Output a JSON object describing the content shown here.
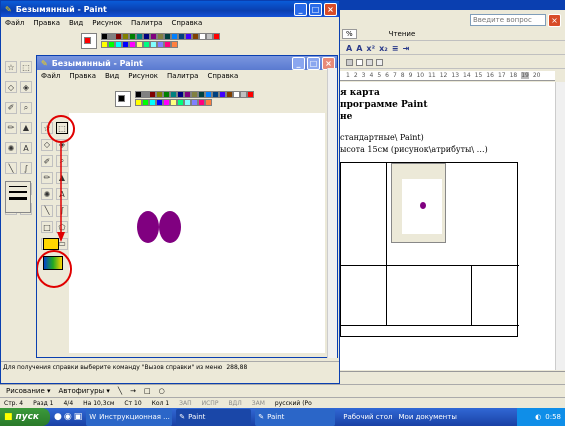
{
  "outer_paint": {
    "title": "Безымянный - Paint",
    "menu": [
      "Файл",
      "Правка",
      "Вид",
      "Рисунок",
      "Палитра",
      "Справка"
    ],
    "status": "Для получения справки выберите команду \"Вызов справки\" из меню",
    "coords": "288,88"
  },
  "inner_paint": {
    "title": "Безымянный - Paint",
    "menu": [
      "Файл",
      "Правка",
      "Вид",
      "Рисунок",
      "Палитра",
      "Справка"
    ]
  },
  "word": {
    "help_placeholder": "Введите вопрос",
    "zoom": "%",
    "reading_label": "Чтение",
    "doc_lines": [
      "я карта",
      "программе Paint",
      "не",
      "стандартные\\ Paint)",
      "ысота 15см (рисунок\\атрибуты\\ …)"
    ],
    "ruler": [
      "1",
      "2",
      "3",
      "4",
      "5",
      "6",
      "7",
      "8",
      "9",
      "10",
      "11",
      "12",
      "13",
      "14",
      "15",
      "16",
      "17",
      "18",
      "19",
      "20"
    ],
    "draw_label": "Рисование ▾",
    "autoshapes_label": "Автофигуры ▾",
    "status": [
      "Стр. 4",
      "Разд 1",
      "4/4",
      "На 10,3см",
      "Ст 10",
      "Кол 1",
      "ЗАП",
      "ИСПР",
      "ВДЛ",
      "ЗАМ",
      "русский (Ро"
    ]
  },
  "palette_colors": [
    "#000000",
    "#808080",
    "#800000",
    "#808000",
    "#008000",
    "#008080",
    "#000080",
    "#800080",
    "#808040",
    "#004040",
    "#0080ff",
    "#004080",
    "#4000ff",
    "#804000",
    "#ffffff",
    "#c0c0c0",
    "#ff0000",
    "#ffff00",
    "#00ff00",
    "#00ffff",
    "#0000ff",
    "#ff00ff",
    "#ffff80",
    "#00ff80",
    "#80ffff",
    "#8080ff",
    "#ff0080",
    "#ff8040"
  ],
  "taskbar": {
    "start": "пуск",
    "buttons": [
      "Инструкционная ...",
      "Paint",
      "Paint"
    ],
    "tray_items": [
      "Рабочий стол",
      "Мои документы"
    ],
    "clock": "0:58"
  }
}
